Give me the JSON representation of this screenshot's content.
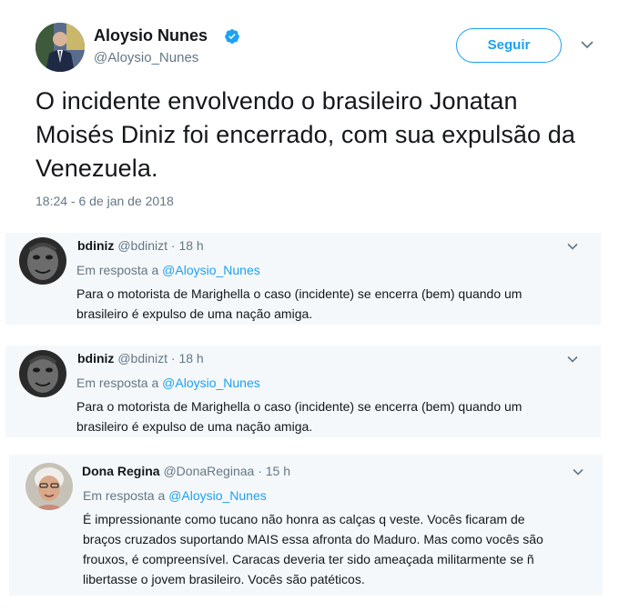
{
  "main_tweet": {
    "name": "Aloysio Nunes",
    "handle": "@Aloysio_Nunes",
    "follow_label": "Seguir",
    "text": "O incidente envolvendo o brasileiro Jonatan Moisés Diniz foi encerrado, com sua expulsão da Venezuela.",
    "timestamp": "18:24 - 6 de jan de 2018",
    "icons": [
      "verified-badge-icon",
      "chevron-down-icon"
    ]
  },
  "replies": [
    {
      "name": "bdiniz",
      "handle": "@bdinizt",
      "dot": "·",
      "time": "18 h",
      "in_reply_prefix": "Em resposta a",
      "in_reply_mention": "@Aloysio_Nunes",
      "text_lines": [
        "Para o motorista de Marighella o caso (incidente) se encerra (bem) quando um",
        "brasileiro é expulso de uma nação amiga."
      ]
    },
    {
      "name": "bdiniz",
      "handle": "@bdinizt",
      "dot": "·",
      "time": "18 h",
      "in_reply_prefix": "Em resposta a",
      "in_reply_mention": "@Aloysio_Nunes",
      "text_lines": [
        "Para o motorista de Marighella o caso (incidente) se encerra (bem) quando um",
        "brasileiro é expulso de uma nação amiga."
      ]
    },
    {
      "name": "Dona Regina",
      "handle": "@DonaReginaa",
      "dot": "·",
      "time": "15 h",
      "in_reply_prefix": "Em resposta a",
      "in_reply_mention": "@Aloysio_Nunes",
      "text_lines": [
        "É impressionante como tucano não honra as calças q veste. Vocês ficaram de",
        "braços cruzados suportando MAIS essa afronta do Maduro. Mas como vocês são",
        "frouxos, é compreensível. Caracas deveria ter sido ameaçada militarmente se ñ",
        "libertasse o jovem brasileiro. Vocês são patéticos."
      ]
    }
  ],
  "colors": {
    "accent": "#1da1f2",
    "muted_text": "#657786",
    "reply_background": "#f5f8fa"
  }
}
